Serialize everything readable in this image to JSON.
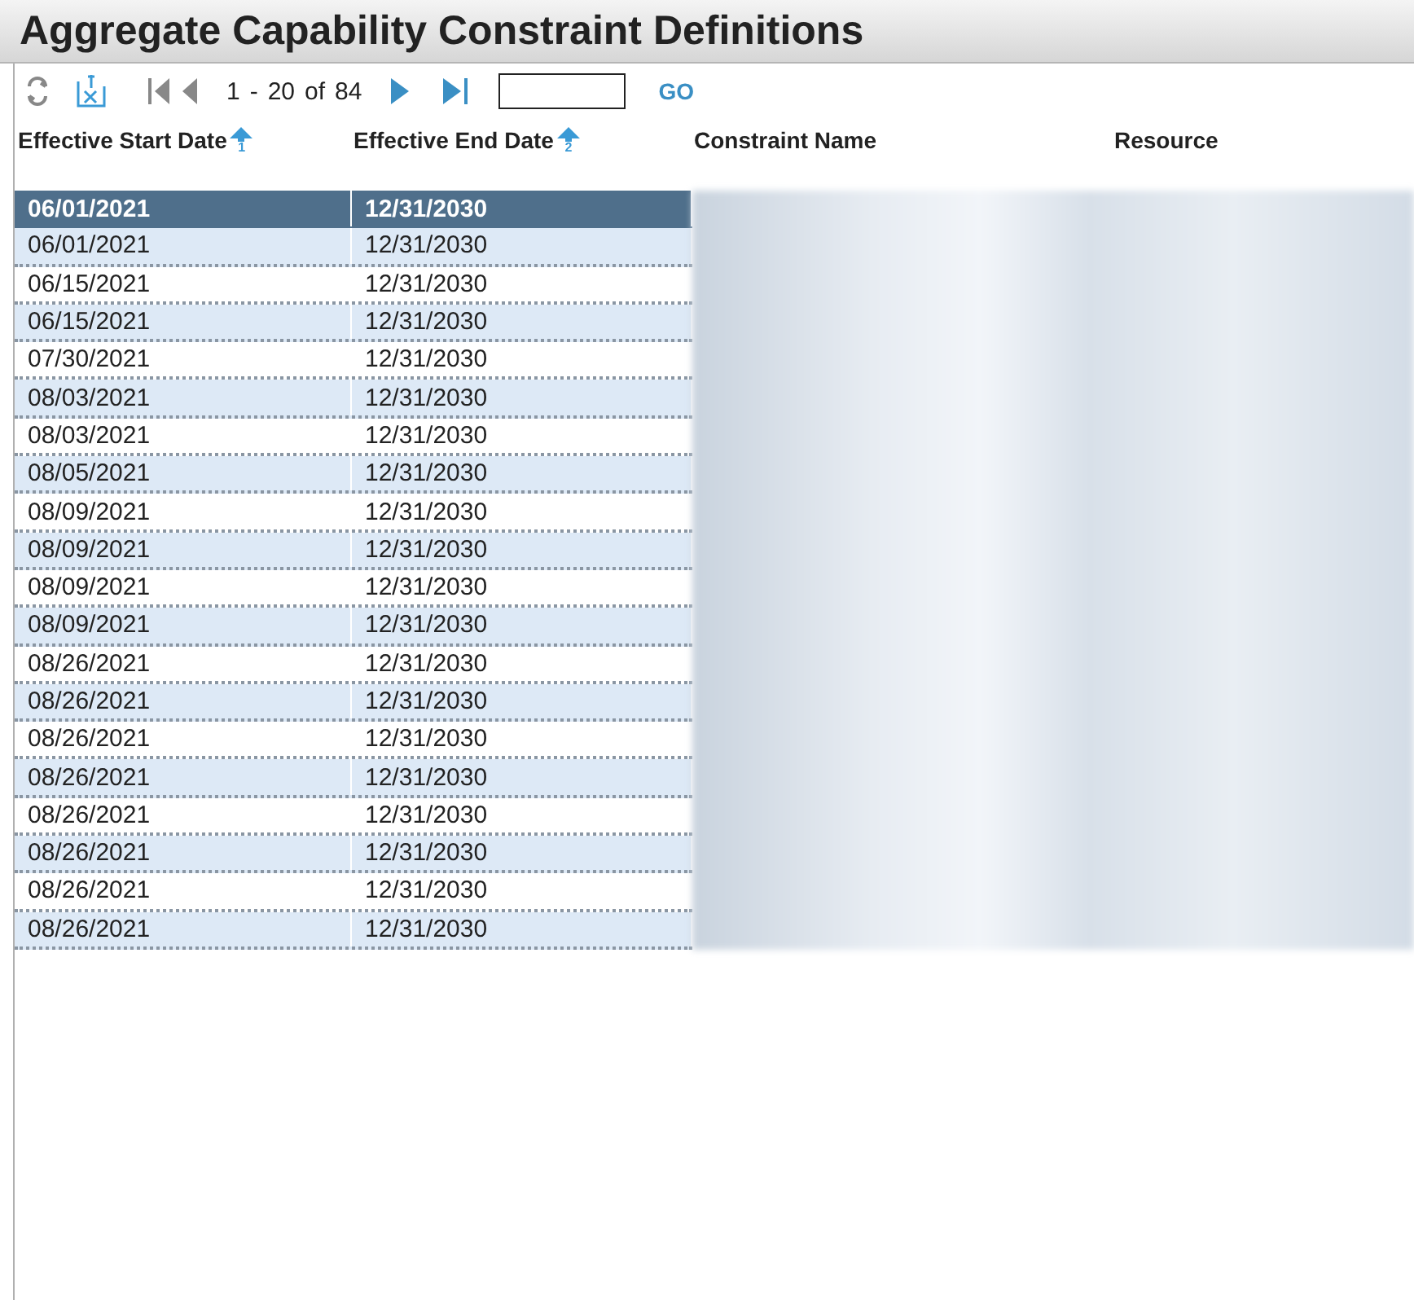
{
  "window": {
    "title": "Aggregate Capability Constraint Definitions"
  },
  "pager": {
    "from": "1",
    "separator": "-",
    "to": "20",
    "of_label": "of",
    "total": "84",
    "go_label": "GO"
  },
  "table": {
    "columns": [
      {
        "label": "Effective Start Date",
        "sorted": true,
        "sort_order": "1"
      },
      {
        "label": "Effective End Date",
        "sorted": true,
        "sort_order": "2"
      },
      {
        "label": "Constraint Name",
        "sorted": false
      },
      {
        "label": "Resource",
        "sorted": false
      }
    ],
    "rows": [
      {
        "start": "06/01/2021",
        "end": "12/31/2030",
        "selected": true
      },
      {
        "start": "06/01/2021",
        "end": "12/31/2030",
        "selected": false
      },
      {
        "start": "06/15/2021",
        "end": "12/31/2030",
        "selected": false
      },
      {
        "start": "06/15/2021",
        "end": "12/31/2030",
        "selected": false
      },
      {
        "start": "07/30/2021",
        "end": "12/31/2030",
        "selected": false
      },
      {
        "start": "08/03/2021",
        "end": "12/31/2030",
        "selected": false
      },
      {
        "start": "08/03/2021",
        "end": "12/31/2030",
        "selected": false
      },
      {
        "start": "08/05/2021",
        "end": "12/31/2030",
        "selected": false
      },
      {
        "start": "08/09/2021",
        "end": "12/31/2030",
        "selected": false
      },
      {
        "start": "08/09/2021",
        "end": "12/31/2030",
        "selected": false
      },
      {
        "start": "08/09/2021",
        "end": "12/31/2030",
        "selected": false
      },
      {
        "start": "08/09/2021",
        "end": "12/31/2030",
        "selected": false
      },
      {
        "start": "08/26/2021",
        "end": "12/31/2030",
        "selected": false
      },
      {
        "start": "08/26/2021",
        "end": "12/31/2030",
        "selected": false
      },
      {
        "start": "08/26/2021",
        "end": "12/31/2030",
        "selected": false
      },
      {
        "start": "08/26/2021",
        "end": "12/31/2030",
        "selected": false
      },
      {
        "start": "08/26/2021",
        "end": "12/31/2030",
        "selected": false
      },
      {
        "start": "08/26/2021",
        "end": "12/31/2030",
        "selected": false
      },
      {
        "start": "08/26/2021",
        "end": "12/31/2030",
        "selected": false
      },
      {
        "start": "08/26/2021",
        "end": "12/31/2030",
        "selected": false
      }
    ]
  }
}
